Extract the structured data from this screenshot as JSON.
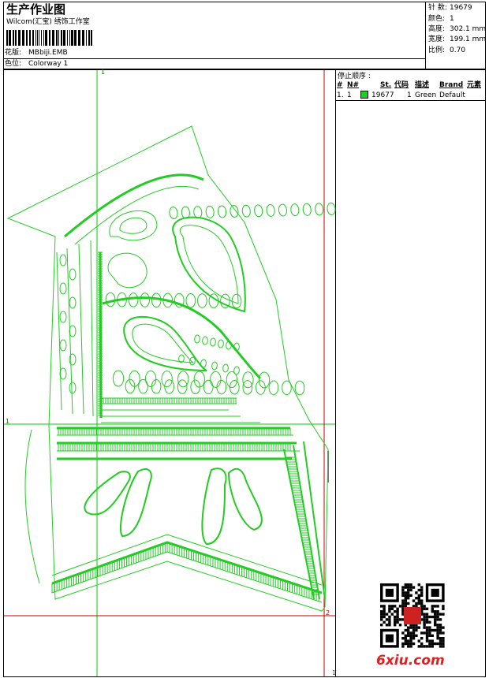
{
  "header": {
    "title": "生产作业图",
    "company": "Wilcom(汇宝) 绣饰工作室",
    "design_label": "花版:",
    "design_value": "MBbiji.EMB",
    "colorway_label": "色位:",
    "colorway_value": "Colorway 1"
  },
  "stats": [
    {
      "label": "针 数:",
      "value": "19679"
    },
    {
      "label": "颜色:",
      "value": "1"
    },
    {
      "label": "高度:",
      "value": "302.1 mm"
    },
    {
      "label": "宽度:",
      "value": "199.1 mm"
    },
    {
      "label": "比例:",
      "value": "0.70"
    }
  ],
  "stop_sequence": {
    "title": "停止顺序 :",
    "columns": [
      "#",
      "N#",
      "St.",
      "代码",
      "描述",
      "Brand",
      "元素"
    ],
    "rows": [
      {
        "num": "1.",
        "n": "1",
        "code": "19677",
        "st": "1",
        "desc": "Green",
        "brand": "Default"
      }
    ]
  },
  "guides": {
    "top_label": "1",
    "left_label": "1",
    "corner_label": "2",
    "bottom_right_label": "1"
  },
  "watermark": "6xiu.com",
  "colors": {
    "stitch": "#22cc22",
    "guide": "#00cc00",
    "guide_red": "#cc0000",
    "watermark": "#e02020"
  }
}
